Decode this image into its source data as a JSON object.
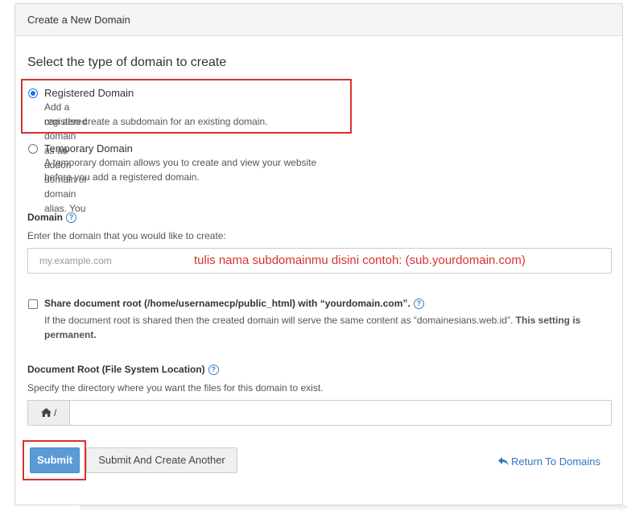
{
  "panel": {
    "title": "Create a New Domain"
  },
  "domain_type": {
    "heading": "Select the type of domain to create",
    "options": [
      {
        "label": "Registered Domain",
        "desc_line1": "Add a registered domain as an addon domain or domain alias. You",
        "desc_line2": "can also create a subdomain for an existing domain.",
        "checked": true
      },
      {
        "label": "Temporary Domain",
        "desc_line1": "A temporary domain allows you to create and view your website",
        "desc_line2": "before you add a registered domain.",
        "checked": false
      }
    ]
  },
  "domain_field": {
    "label": "Domain",
    "help": "Enter the domain that you would like to create:",
    "placeholder": "my.example.com",
    "annotation": "tulis nama subdomainmu disini contoh: (sub.yourdomain.com)"
  },
  "share_root": {
    "label": "Share document root (/home/usernamecp/public_html) with “yourdomain.com”.",
    "desc_part1": "If the document root is shared then the created domain will serve the same content as “domainesians.web.id”.",
    "desc_bold": "This setting is permanent.",
    "checked": false
  },
  "doc_root": {
    "label": "Document Root (File System Location)",
    "help": "Specify the directory where you want the files for this domain to exist.",
    "prefix": "/",
    "value": ""
  },
  "actions": {
    "submit": "Submit",
    "submit_another": "Submit And Create Another",
    "return": "Return To Domains"
  },
  "colors": {
    "accent": "#5b9bd5",
    "link": "#2f77c0",
    "annotation_red": "#d9322c"
  },
  "icons": [
    "question-circle-icon",
    "home-icon",
    "reply-arrow-icon"
  ]
}
